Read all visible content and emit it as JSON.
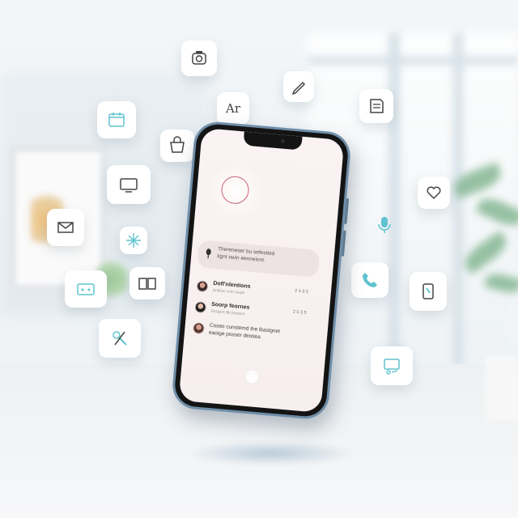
{
  "screen": {
    "voice_note": {
      "line1": "Thereneser bu sefestted",
      "line2": "tignt owin eenneiont."
    },
    "list": [
      {
        "title": "Dofl'nlentions",
        "subtitle": "Antifoe coirs kepe",
        "time": "2 4 3 5"
      },
      {
        "title": "Soorp feornes",
        "subtitle": "Snstpel tilk brotwot",
        "time": "2 5 3 5"
      },
      {
        "text_line1": "Coseo cunstemd the lbaslgnet",
        "text_line2": "eaoige posser deotiea"
      }
    ]
  },
  "floating_icons": {
    "translate": {
      "label": "Ar"
    }
  },
  "colors": {
    "accent": "#5fc3cf",
    "record_ring": "#c8607a",
    "phone_frame": "#6f8ea8",
    "screen_bg": "#f9f1f1"
  },
  "icons": [
    "camera-icon",
    "pencil-icon",
    "translate-icon",
    "notes-icon",
    "calendar-icon",
    "shopping-icon",
    "tv-icon",
    "heart-tag-icon",
    "mail-icon",
    "microphone-icon",
    "sparkle-icon",
    "ticket-icon",
    "book-icon",
    "phone-icon",
    "bottle-icon",
    "tools-icon",
    "monitor-icon"
  ]
}
